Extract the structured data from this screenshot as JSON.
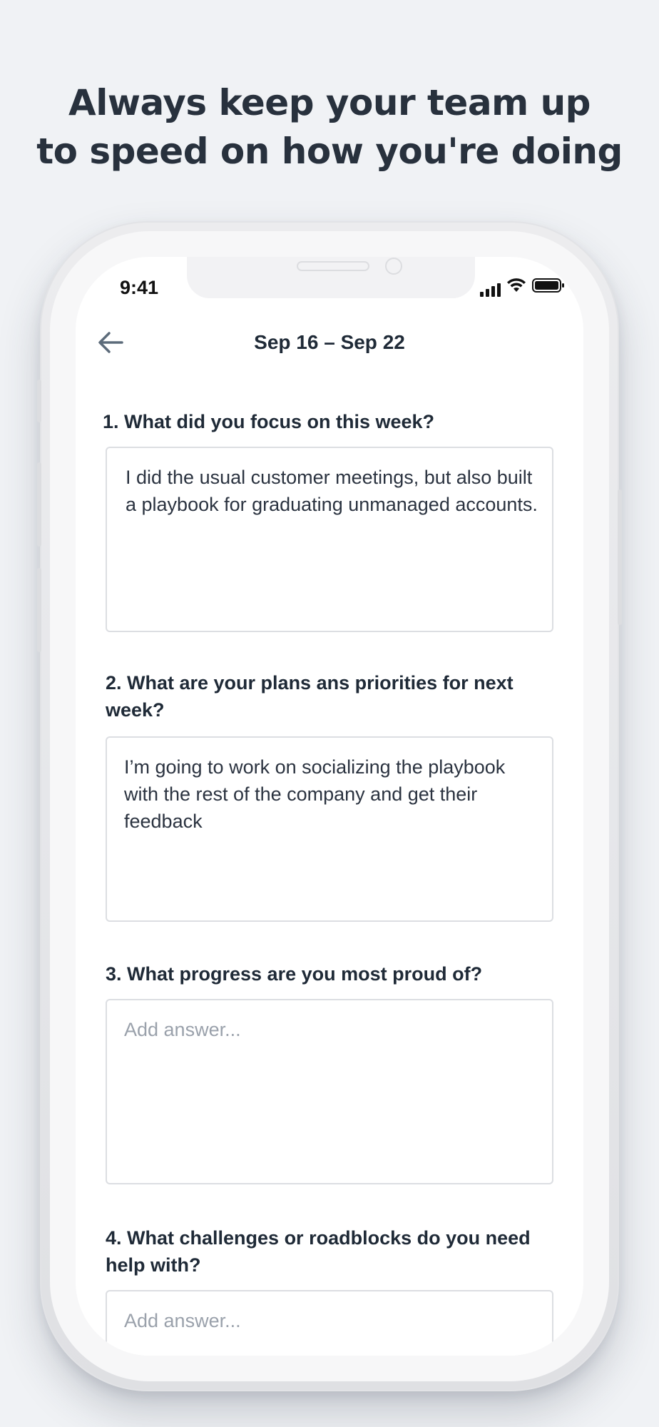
{
  "headline": {
    "line1": "Always keep your team up",
    "line2": "to speed on how you're doing"
  },
  "status_bar": {
    "time": "9:41",
    "icons": [
      "signal-icon",
      "wifi-icon",
      "battery-icon"
    ]
  },
  "nav": {
    "back_icon": "arrow-left-icon",
    "title": "Sep 16 – Sep 22"
  },
  "questions": [
    {
      "label": "1. What did you focus on this week?",
      "answer": "I did the usual customer meetings, but also built a playbook for graduating unmanaged accounts.",
      "placeholder": "Add answer..."
    },
    {
      "label": "2. What are your plans ans priorities for next week?",
      "answer": "I’m going to work on socializing the playbook with the rest of the company and get their feedback",
      "placeholder": "Add answer..."
    },
    {
      "label": "3. What progress are you most proud of?",
      "answer": "",
      "placeholder": "Add answer..."
    },
    {
      "label": "4. What challenges or roadblocks do you need help with?",
      "answer": "",
      "placeholder": "Add answer..."
    }
  ],
  "colors": {
    "background": "#f0f2f5",
    "text_dark": "#1f2a37",
    "placeholder": "#9aa1ab",
    "border": "#dcdee2",
    "back_arrow": "#5c6b7a"
  }
}
